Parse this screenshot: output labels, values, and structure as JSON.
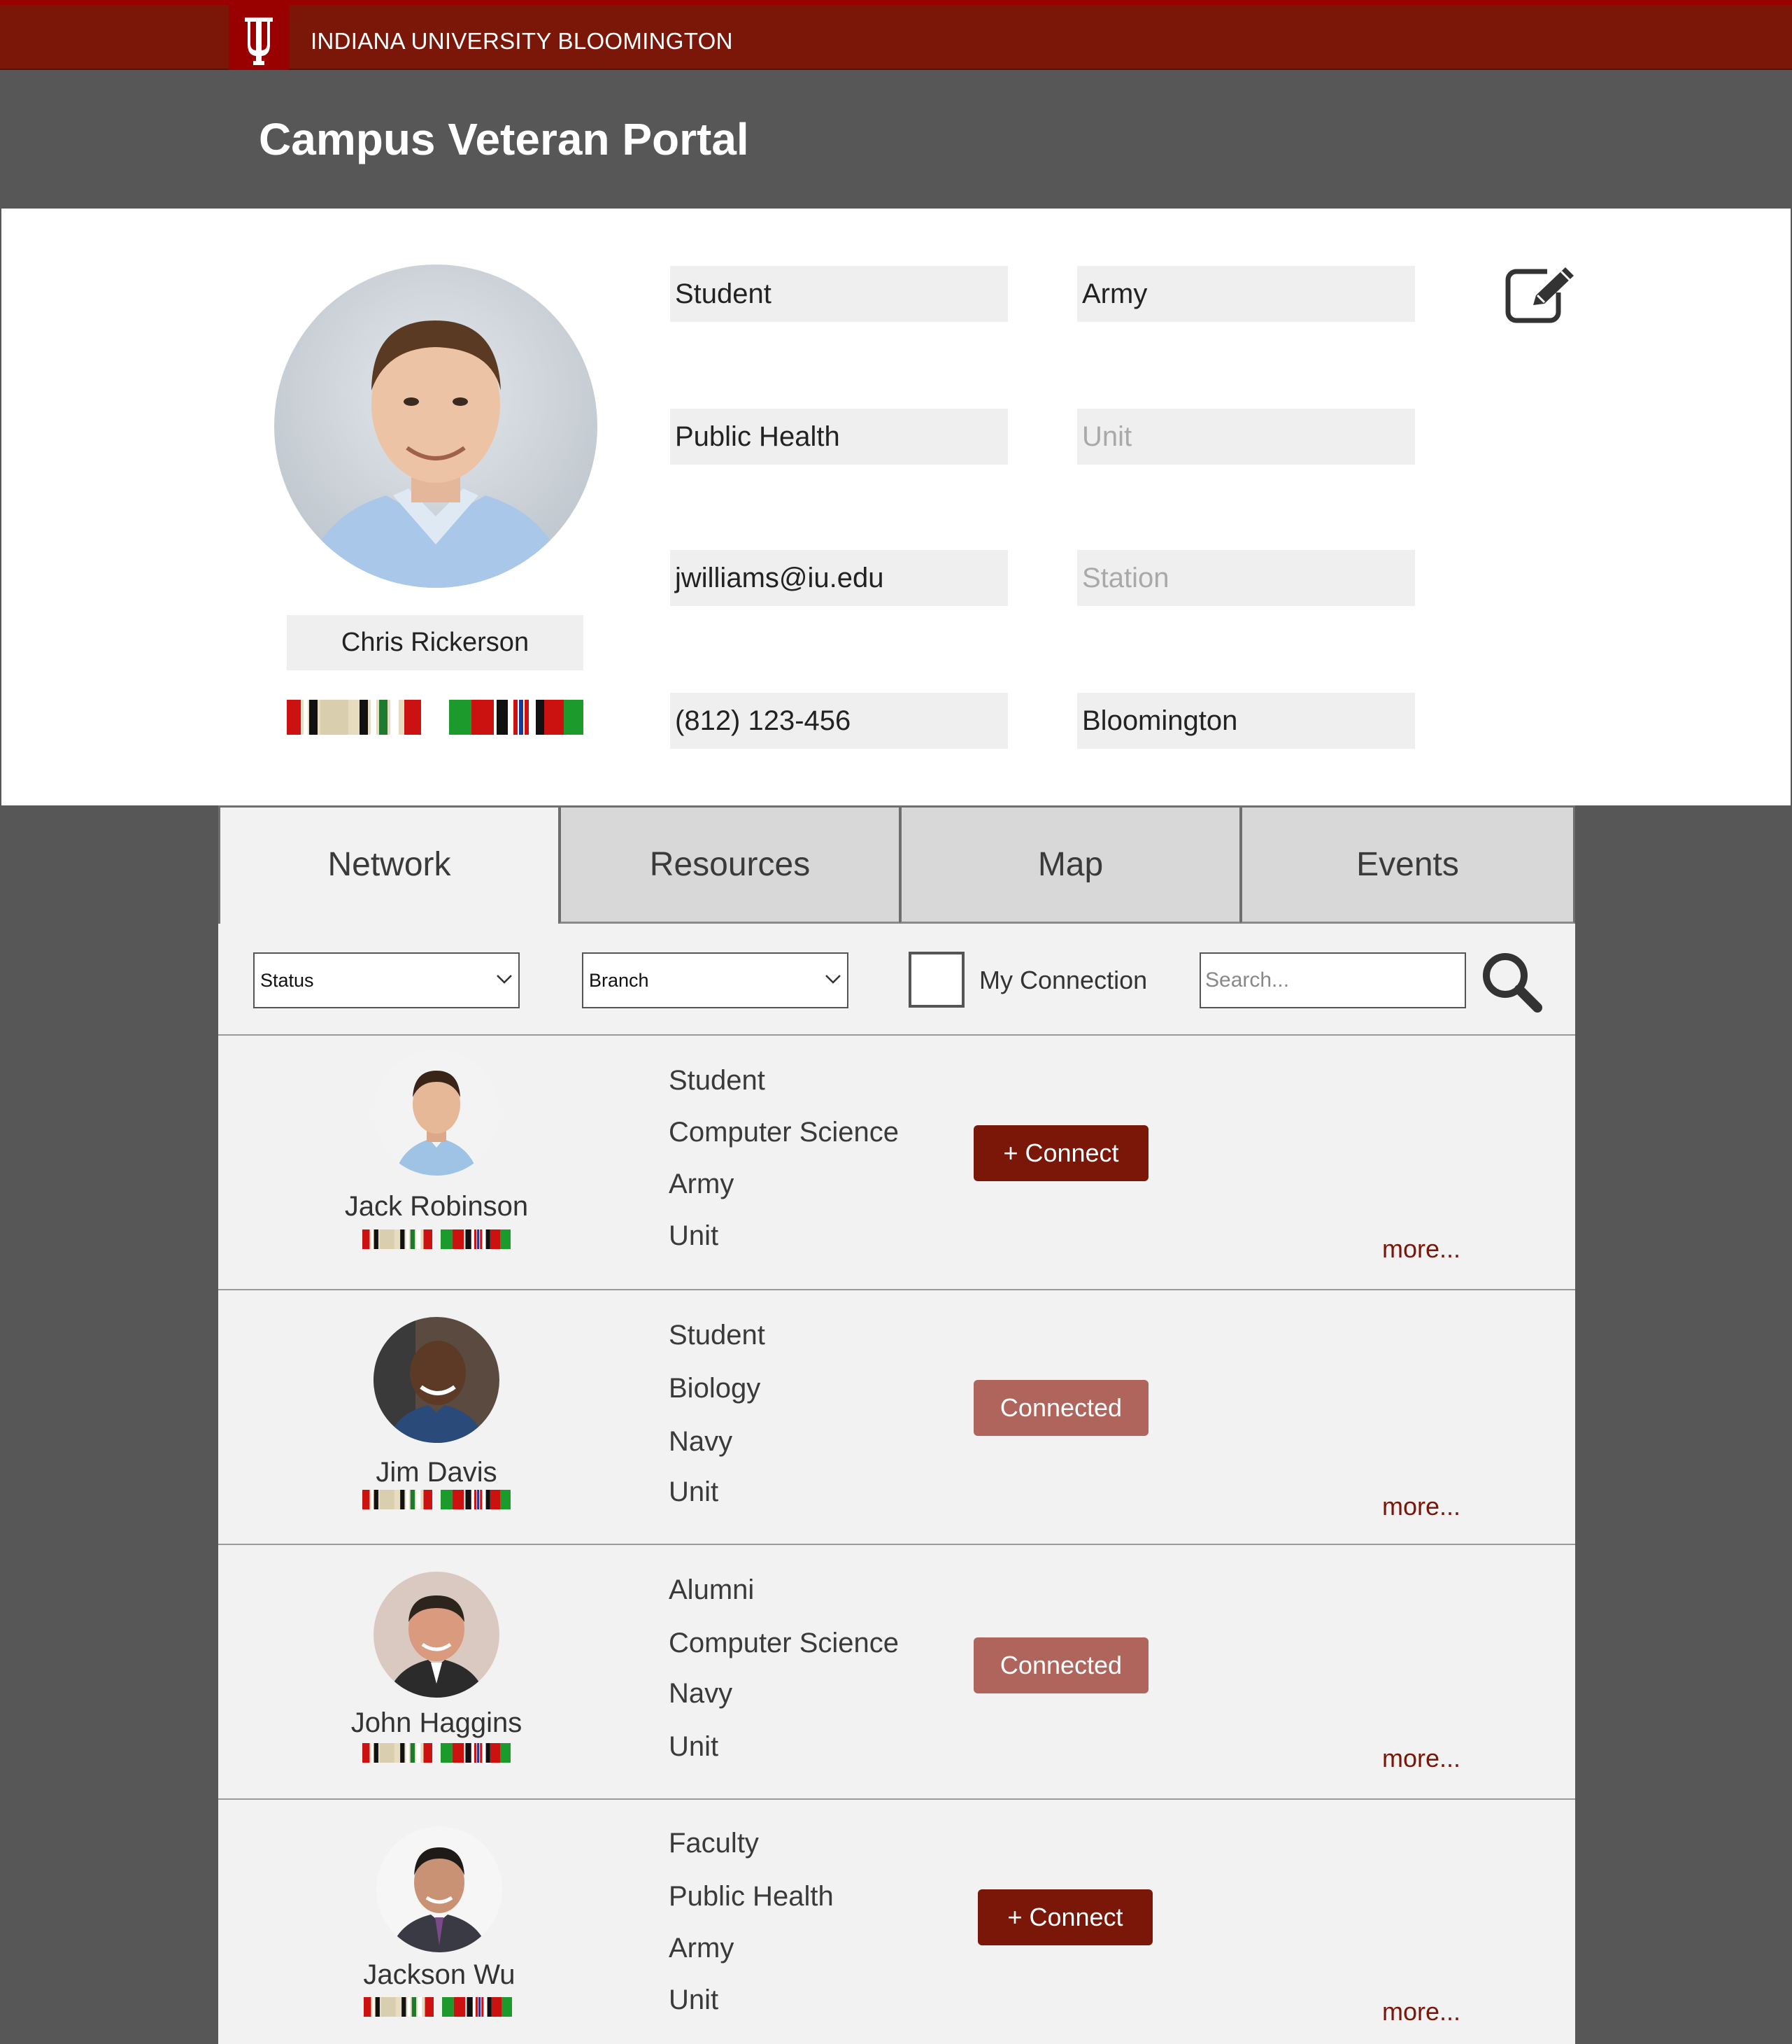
{
  "brand": {
    "university": "INDIANA UNIVERSITY BLOOMINGTON",
    "color": "#7a1708"
  },
  "portal": {
    "title": "Campus Veteran Portal"
  },
  "profile": {
    "name": "Chris Rickerson",
    "fields": {
      "status": "Student",
      "branch": "Army",
      "major": "Public Health",
      "unit_placeholder": "Unit",
      "email": "jwilliams@iu.edu",
      "station_placeholder": "Station",
      "phone": "(812) 123-456",
      "city": "Bloomington"
    },
    "edit_icon": "edit-icon"
  },
  "tabs": [
    {
      "label": "Network"
    },
    {
      "label": "Resources"
    },
    {
      "label": "Map"
    },
    {
      "label": "Events"
    }
  ],
  "filters": {
    "status_select": "Status",
    "branch_select": "Branch",
    "my_connection_label": "My Connection",
    "search_placeholder": "Search...",
    "search_icon": "search-icon"
  },
  "members": [
    {
      "name": "Jack Robinson",
      "role": "Student",
      "major": "Computer Science",
      "branch": "Army",
      "unit": "Unit",
      "action": "+ Connect",
      "more": "more..."
    },
    {
      "name": "Jim Davis",
      "role": "Student",
      "major": "Biology",
      "branch": "Navy",
      "unit": "Unit",
      "action": "Connected",
      "more": "more..."
    },
    {
      "name": "John Haggins",
      "role": "Alumni",
      "major": "Computer Science",
      "branch": "Navy",
      "unit": "Unit",
      "action": "Connected",
      "more": "more..."
    },
    {
      "name": "Jackson Wu",
      "role": "Faculty",
      "major": "Public Health",
      "branch": "Army",
      "unit": "Unit",
      "action": "+ Connect",
      "more": "more..."
    }
  ]
}
